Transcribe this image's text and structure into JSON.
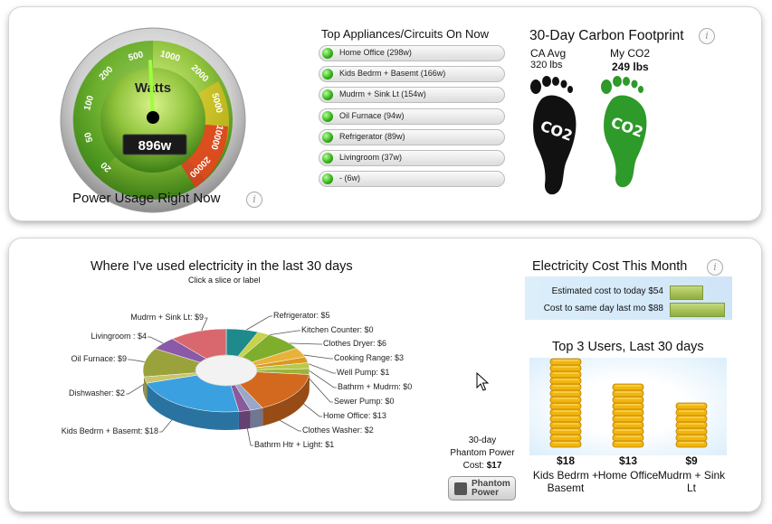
{
  "gauge": {
    "title": "Watts",
    "reading": "896w",
    "caption": "Power Usage Right Now",
    "scale": [
      "20",
      "50",
      "100",
      "200",
      "500",
      "1000",
      "2000",
      "5000",
      "10000",
      "20000"
    ]
  },
  "appliances": {
    "title": "Top Appliances/Circuits On Now",
    "items": [
      {
        "label": "Home Office (298w)"
      },
      {
        "label": "Kids Bedrm + Basemt (166w)"
      },
      {
        "label": "Mudrm + Sink Lt (154w)"
      },
      {
        "label": "Oil Furnace (94w)"
      },
      {
        "label": "Refrigerator (89w)"
      },
      {
        "label": "Livingroom (37w)"
      },
      {
        "label": "- (6w)"
      }
    ]
  },
  "carbon": {
    "title": "30-Day Carbon Footprint",
    "ca_label": "CA Avg",
    "ca_value": "320 lbs",
    "my_label": "My CO2",
    "my_value": "249 lbs",
    "foot_text": "CO2"
  },
  "pie": {
    "title": "Where I've used electricity in the last 30 days",
    "subtitle": "Click a slice or label",
    "labels": [
      "Mudrm + Sink Lt: $9",
      "Livingroom : $4",
      "Oil Furnace: $9",
      "Dishwasher: $2",
      "Kids Bedrm + Basemt: $18",
      "Refrigerator: $5",
      "Kitchen Counter: $0",
      "Clothes Dryer: $6",
      "Cooking Range: $3",
      "Well Pump: $1",
      "Bathrm + Mudrm: $0",
      "Sewer Pump: $0",
      "Home Office: $13",
      "Clothes Washer: $2",
      "Bathrm Htr + Light: $1"
    ]
  },
  "chart_data": [
    {
      "type": "pie",
      "title": "Where I've used electricity in the last 30 days",
      "categories": [
        "Refrigerator",
        "Kitchen Counter",
        "Clothes Dryer",
        "Cooking Range",
        "Well Pump",
        "Bathrm + Mudrm",
        "Sewer Pump",
        "Home Office",
        "Clothes Washer",
        "Bathrm Htr + Light",
        "Kids Bedrm + Basemt",
        "Dishwasher",
        "Oil Furnace",
        "Livingroom",
        "Mudrm + Sink Lt"
      ],
      "values": [
        5,
        0,
        6,
        3,
        1,
        0,
        0,
        13,
        2,
        1,
        18,
        2,
        9,
        4,
        9
      ],
      "colors": [
        "#1f8a8c",
        "#c9d24a",
        "#7fae2d",
        "#e8b23a",
        "#d99a1f",
        "#b7c94a",
        "#9ab53c",
        "#d2691e",
        "#9aa7c8",
        "#8a5a9c",
        "#3aa0e0",
        "#c9c66a",
        "#9aa33b",
        "#8a5aa8",
        "#d9686e"
      ]
    },
    {
      "type": "bar",
      "title": "Electricity Cost This Month",
      "categories": [
        "Estimated cost to today $54",
        "Cost to same day last mo $88"
      ],
      "values": [
        54,
        88
      ]
    },
    {
      "type": "bar",
      "title": "Top 3 Users, Last 30 days",
      "categories": [
        "Kids Bedrm + Basemt",
        "Home Office",
        "Mudrm + Sink Lt"
      ],
      "values": [
        18,
        13,
        9
      ]
    }
  ],
  "phantom": {
    "line1": "30-day",
    "line2": "Phantom Power",
    "line3_prefix": "Cost: ",
    "line3_value": "$17",
    "button_label": "Phantom Power"
  },
  "cost": {
    "title": "Electricity Cost This Month",
    "rows": [
      {
        "label": "Estimated cost to today $54",
        "value": 54
      },
      {
        "label": "Cost to same day last mo $88",
        "value": 88
      }
    ]
  },
  "top_users": {
    "title": "Top 3 Users, Last 30 days",
    "users": [
      {
        "amount": "$18",
        "name": "Kids Bedrm + Basemt",
        "value": 18
      },
      {
        "amount": "$13",
        "name": "Home Office",
        "value": 13
      },
      {
        "amount": "$9",
        "name": "Mudrm + Sink Lt",
        "value": 9
      }
    ]
  },
  "info_icon": "i"
}
